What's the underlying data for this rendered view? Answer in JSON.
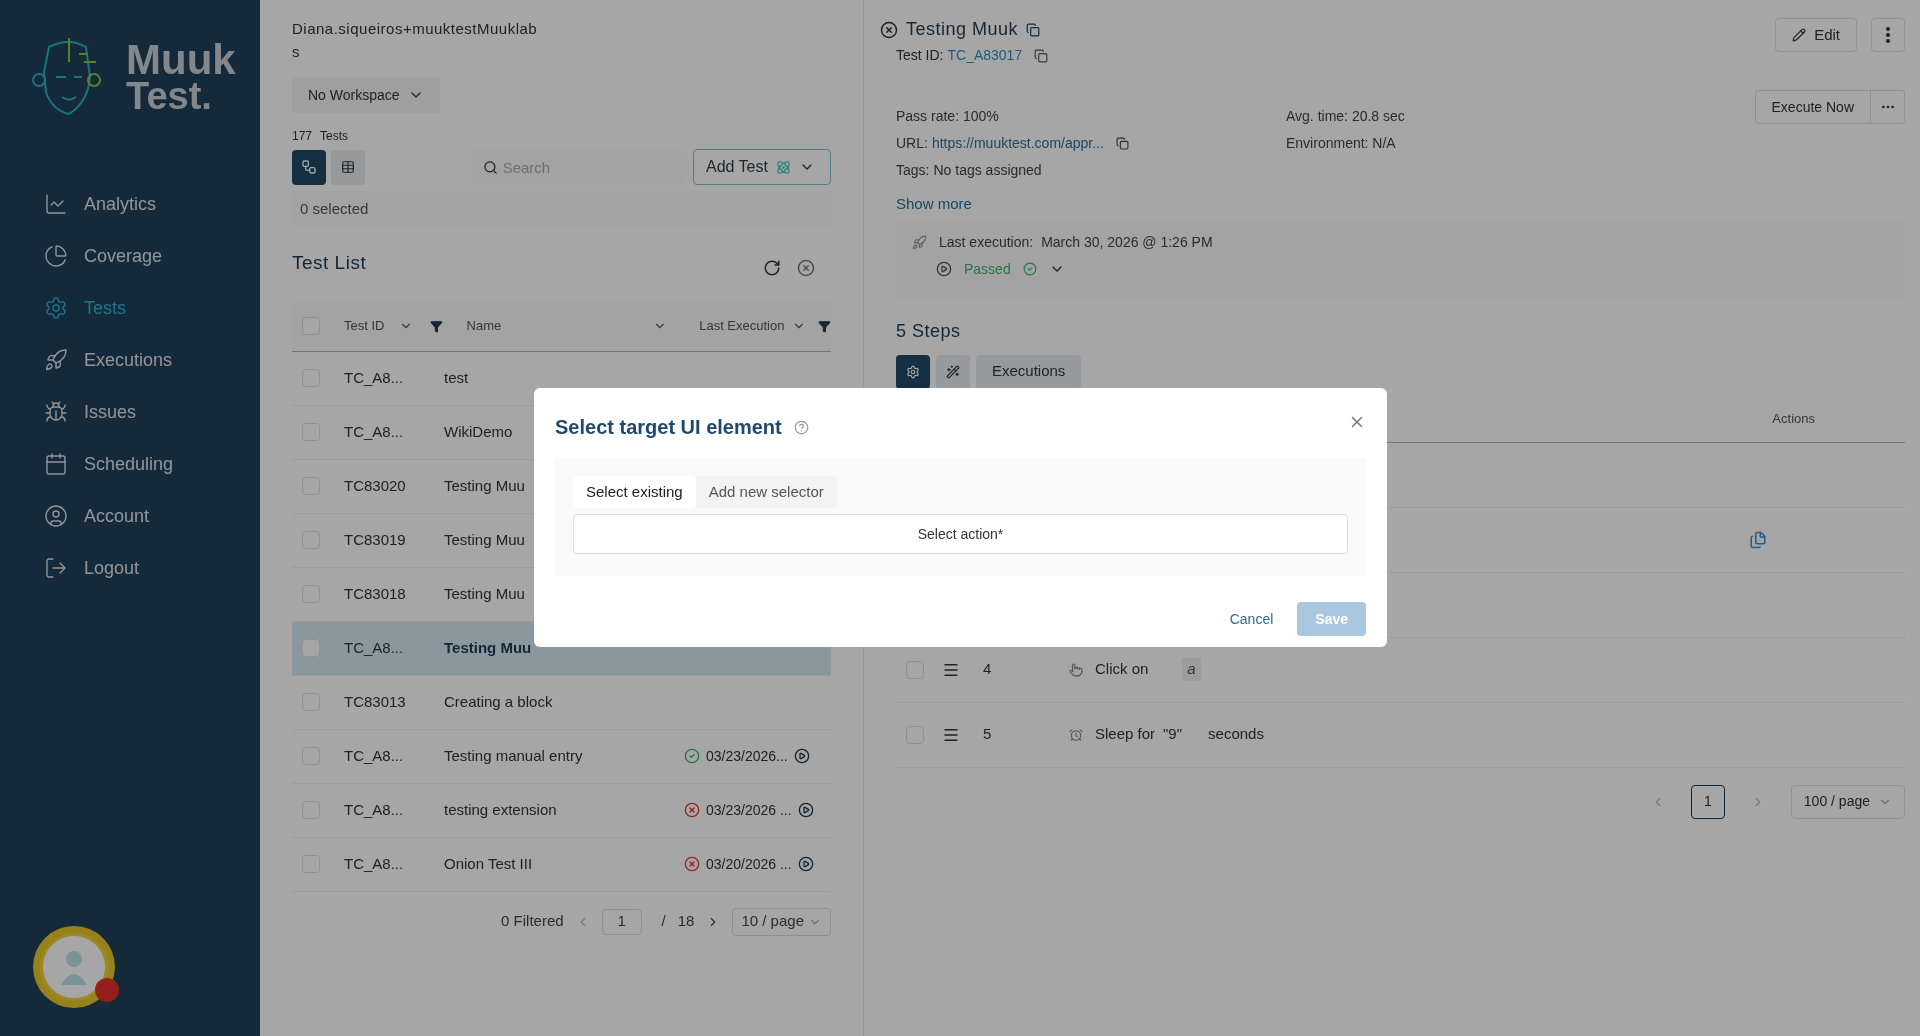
{
  "sidebar": {
    "logo": {
      "line1": "Muuk",
      "line2": "Test."
    },
    "items": [
      {
        "label": "Analytics",
        "kind": "chart",
        "selected": false
      },
      {
        "label": "Coverage",
        "kind": "pie",
        "selected": false
      },
      {
        "label": "Tests",
        "kind": "gear",
        "selected": true
      },
      {
        "label": "Executions",
        "kind": "rocket",
        "selected": false
      },
      {
        "label": "Issues",
        "kind": "bug",
        "selected": false
      },
      {
        "label": "Scheduling",
        "kind": "calendar",
        "selected": false
      },
      {
        "label": "Account",
        "kind": "user",
        "selected": false
      },
      {
        "label": "Logout",
        "kind": "logout",
        "selected": false
      }
    ]
  },
  "tests": {
    "user": "Diana.siqueiros+muuktestMuuklab",
    "user_line2": "s",
    "workspace": "No Workspace",
    "count": "177",
    "count_label": "Tests",
    "search": {
      "placeholder": "Search"
    },
    "add_button": "Add Test",
    "selected_count": "0 selected",
    "title": "Test List",
    "columns": [
      "Test ID",
      "Name",
      "Last Execution"
    ],
    "all_checked": false,
    "rows": [
      {
        "id": "TC_A8...",
        "name": "test",
        "checked": false,
        "selected": false
      },
      {
        "id": "TC_A8...",
        "name": "WikiDemo",
        "checked": false,
        "selected": false
      },
      {
        "id": "TC83020",
        "name": "Testing Muu",
        "checked": false,
        "selected": false
      },
      {
        "id": "TC83019",
        "name": "Testing Muu",
        "checked": false,
        "selected": false
      },
      {
        "id": "TC83018",
        "name": "Testing Muu",
        "checked": false,
        "selected": false
      },
      {
        "id": "TC_A8...",
        "name": "Testing Muu",
        "checked": false,
        "selected": true
      },
      {
        "id": "TC83013",
        "name": "Creating a block",
        "checked": false,
        "selected": false
      },
      {
        "id": "TC_A8...",
        "name": "Testing manual entry",
        "passed": true,
        "date": "03/23/2026...",
        "checked": false,
        "selected": false
      },
      {
        "id": "TC_A8...",
        "name": "testing extension",
        "passed": false,
        "date": "03/23/2026 ...",
        "checked": false,
        "selected": false
      },
      {
        "id": "TC_A8...",
        "name": "Onion Test III",
        "passed": false,
        "date": "03/20/2026 ...",
        "checked": false,
        "selected": false
      }
    ],
    "pagination": {
      "filtered": "0 Filtered",
      "page": "1",
      "separator": "/",
      "total": "18",
      "per_page": "10 / page"
    }
  },
  "detail": {
    "title": "Testing Muuk",
    "test_id_label": "Test ID:",
    "test_id": "TC_A83017",
    "edit": "Edit",
    "execute": "Execute Now",
    "pass_rate": "Pass rate: 100%",
    "url_label": "URL:",
    "url": "https://muuktest.com/appr...",
    "tags_label": "Tags:",
    "tags": "No tags assigned",
    "avg_time": "Avg. time: 20.8 sec",
    "environment": "Environment: N/A",
    "show_more": "Show more",
    "last_execution_label": "Last execution:",
    "last_execution": "March 30, 2026 @ 1:26 PM",
    "result": "Passed",
    "steps_title": "5 Steps",
    "tabs": [
      {
        "kind": "gear",
        "selected": true
      },
      {
        "kind": "wand",
        "selected": false
      },
      {
        "kind": "text",
        "label": "Executions",
        "selected": false
      }
    ],
    "actions_header": "Actions",
    "steps": [
      {
        "number": "4",
        "kind": "click",
        "action": "Click on",
        "value": "a",
        "checked": false
      },
      {
        "number": "5",
        "kind": "sleep",
        "action": "Sleep for",
        "value": "\"9\"",
        "suffix": "seconds",
        "checked": false
      }
    ],
    "pagination": {
      "page": "1",
      "per_page": "100 / page"
    }
  },
  "modal": {
    "title": "Select target UI element",
    "tabs": [
      {
        "label": "Select existing",
        "selected": true
      },
      {
        "label": "Add new selector",
        "selected": false
      }
    ],
    "select": {
      "placeholder": "Select action*"
    },
    "cancel": "Cancel",
    "save": {
      "label": "Save",
      "disabled": true
    }
  }
}
